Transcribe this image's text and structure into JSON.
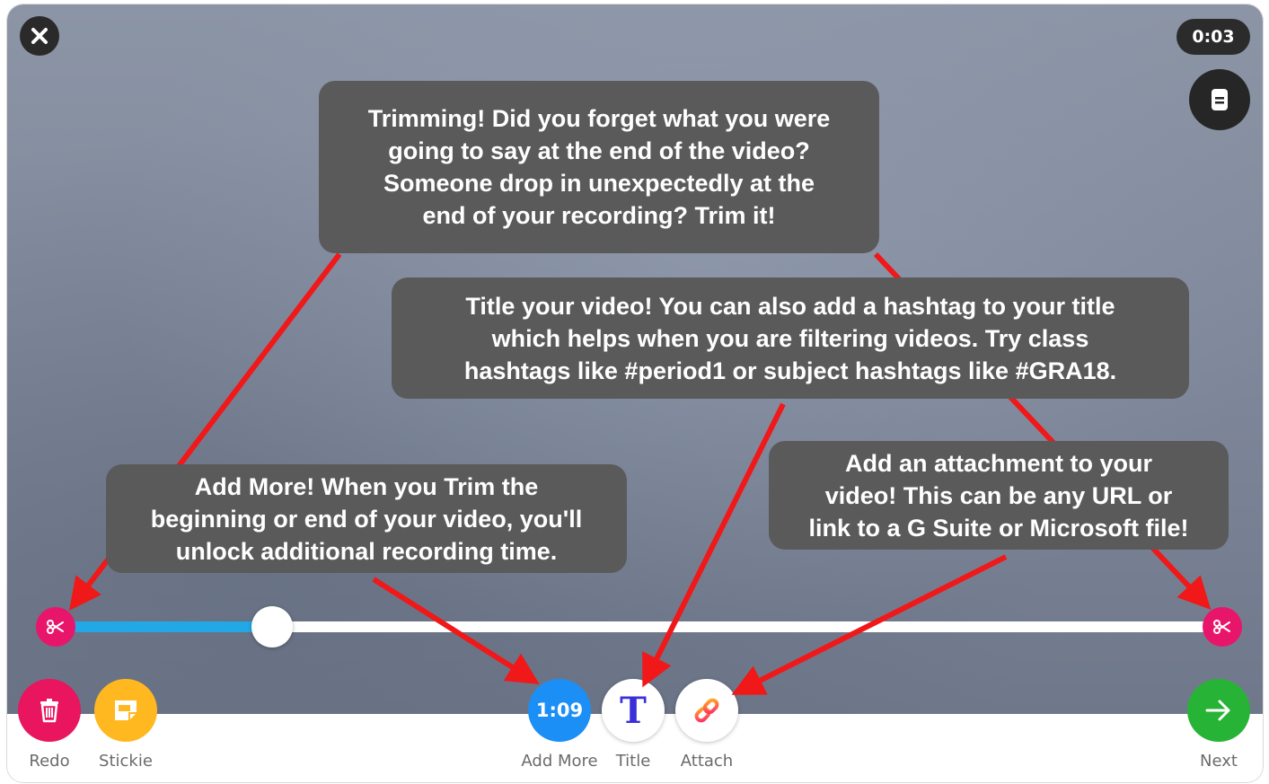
{
  "timer": "0:03",
  "callouts": {
    "trim": [
      "Trimming! Did you forget what you were",
      "going to say at the end of the video?",
      "Someone drop in unexpectedly at the",
      "end of your recording? Trim it!"
    ],
    "title": [
      "Title your video! You can also add a hashtag to your title",
      "which helps when you are filtering videos. Try class",
      "hashtags like #period1 or subject hashtags like #GRA18."
    ],
    "add_more": [
      "Add More! When you Trim the",
      "beginning or end of your video, you'll",
      "unlock additional recording time."
    ],
    "attach": [
      "Add an attachment to your",
      "video! This can be any URL or",
      "link to a G Suite or Microsoft file!"
    ]
  },
  "toolbar": {
    "redo_label": "Redo",
    "stickie_label": "Stickie",
    "add_more_time": "1:09",
    "add_more_label": "Add More",
    "title_icon_letter": "T",
    "title_label": "Title",
    "attach_label": "Attach",
    "next_label": "Next"
  },
  "trim_progress": 0.18,
  "icons": {
    "close": "close-icon",
    "notes": "notes-icon",
    "scissor_left": "scissors-icon",
    "scissor_right": "scissors-icon",
    "redo": "trash-icon",
    "stickie": "stickie-icon",
    "attach": "link-icon",
    "next": "arrow-right-icon"
  },
  "colors": {
    "annotation_arrow": "#f01818",
    "redo": "#e9155e",
    "stickie": "#ffb81f",
    "add_more": "#1b8ff5",
    "next": "#27b336",
    "trim_fill": "#23a8e6"
  }
}
